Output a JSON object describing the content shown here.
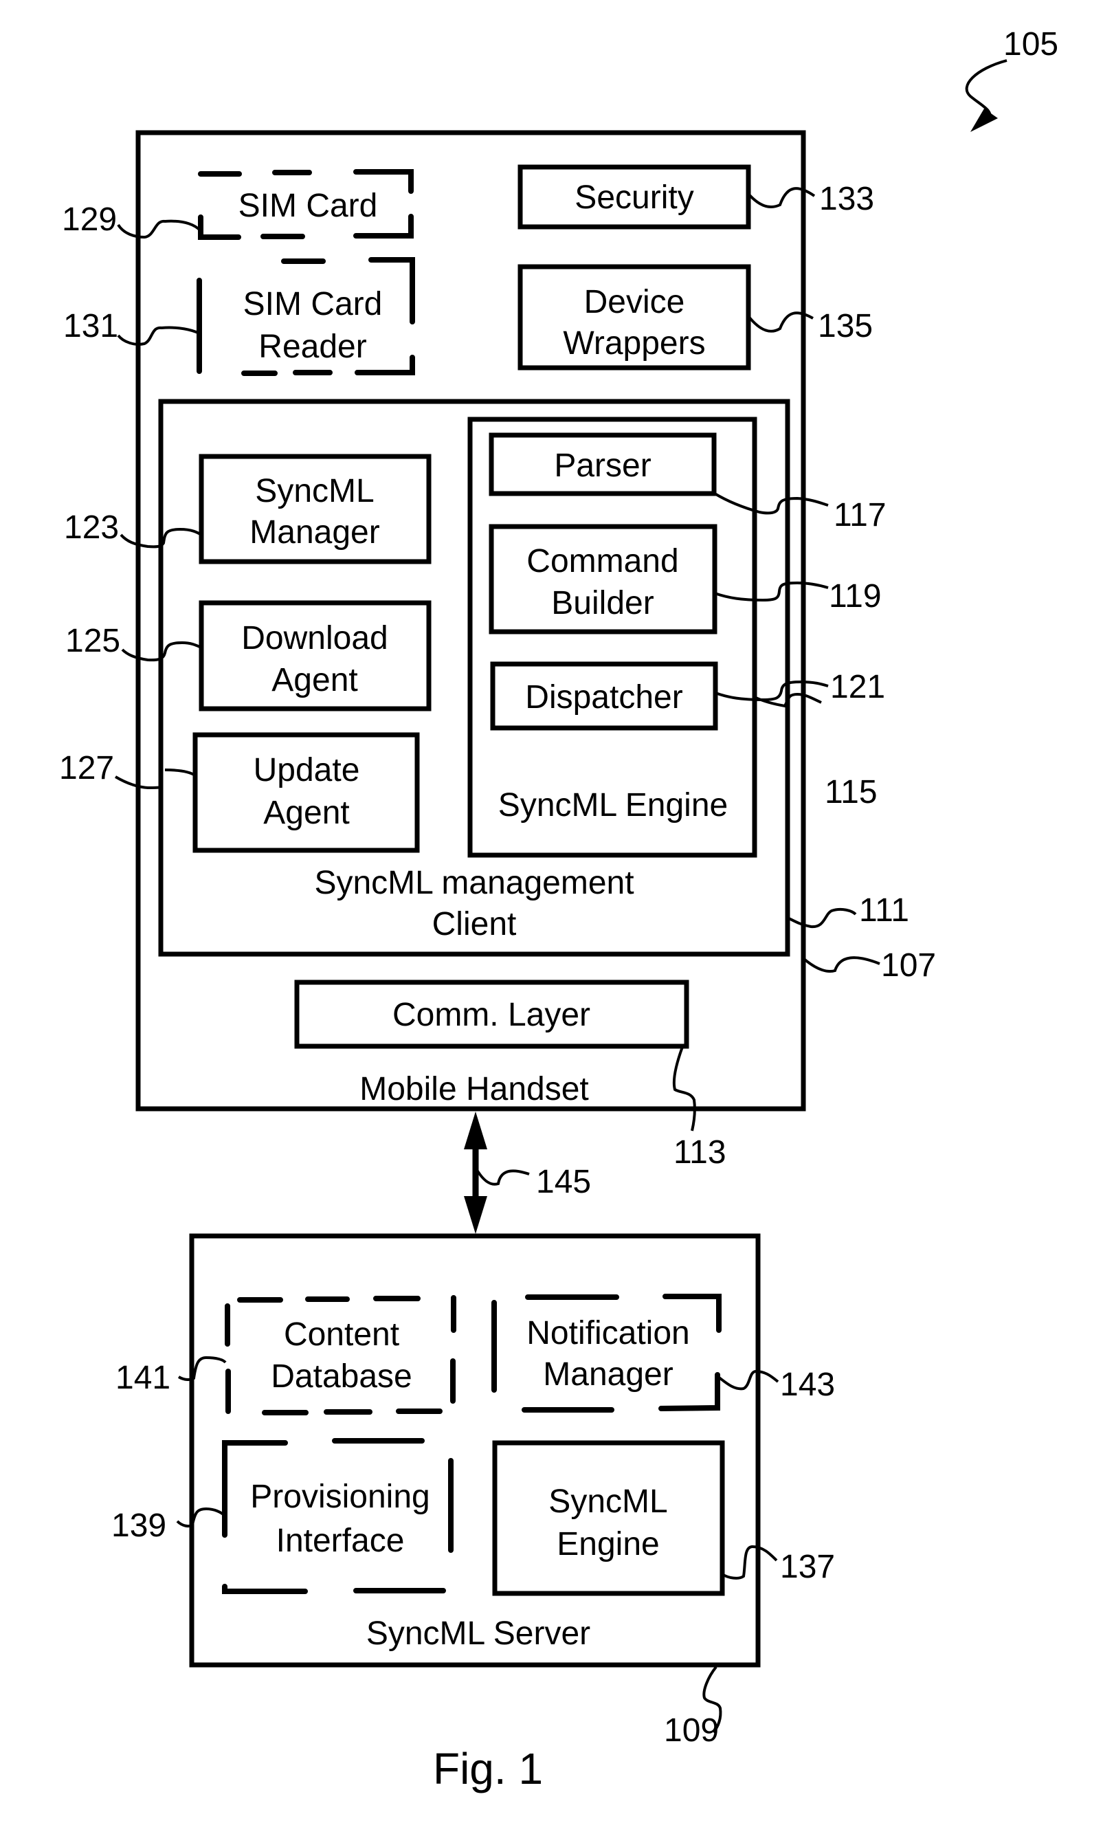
{
  "figure": {
    "caption": "Fig. 1",
    "system_ref": "105"
  },
  "handset": {
    "label": "Mobile Handset",
    "ref": "107",
    "sim_card": {
      "label": "SIM Card",
      "ref": "129",
      "style": "dashed"
    },
    "sim_card_reader": {
      "line1": "SIM Card",
      "line2": "Reader",
      "ref": "131",
      "style": "dashed"
    },
    "security": {
      "label": "Security",
      "ref": "133"
    },
    "device_wrappers": {
      "line1": "Device",
      "line2": "Wrappers",
      "ref": "135"
    },
    "client": {
      "line1": "SyncML management",
      "line2": "Client",
      "ref": "111",
      "syncml_manager": {
        "line1": "SyncML",
        "line2": "Manager",
        "ref": "123"
      },
      "download_agent": {
        "line1": "Download",
        "line2": "Agent",
        "ref": "125"
      },
      "update_agent": {
        "line1": "Update",
        "line2": "Agent",
        "ref": "127"
      },
      "engine": {
        "label": "SyncML Engine",
        "ref": "115",
        "parser": {
          "label": "Parser",
          "ref": "117"
        },
        "command_builder": {
          "line1": "Command",
          "line2": "Builder",
          "ref": "119"
        },
        "dispatcher": {
          "label": "Dispatcher",
          "ref": "121"
        }
      }
    },
    "comm_layer": {
      "label": "Comm. Layer",
      "ref": "113"
    }
  },
  "link": {
    "ref": "145",
    "direction": "bidirectional"
  },
  "server": {
    "label": "SyncML Server",
    "ref": "109",
    "content_database": {
      "line1": "Content",
      "line2": "Database",
      "ref": "141",
      "style": "dashed"
    },
    "notification_manager": {
      "line1": "Notification",
      "line2": "Manager",
      "ref": "143",
      "style": "dashed"
    },
    "provisioning_interface": {
      "line1": "Provisioning",
      "line2": "Interface",
      "ref": "139",
      "style": "dashed"
    },
    "syncml_engine": {
      "line1": "SyncML",
      "line2": "Engine",
      "ref": "137"
    }
  }
}
